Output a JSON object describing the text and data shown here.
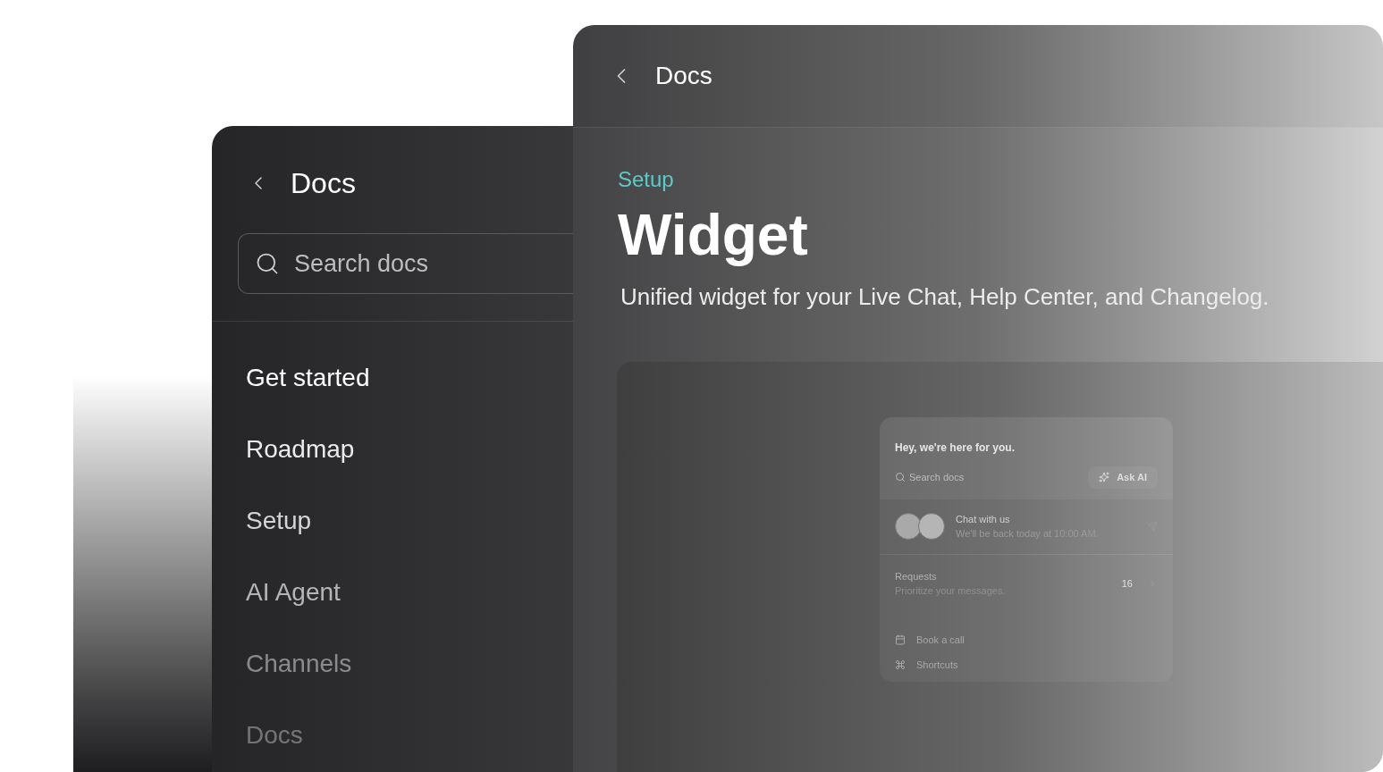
{
  "back_window": {
    "title": "Docs",
    "breadcrumb": "Setup",
    "heading": "Widget",
    "description": "Unified widget for your Live Chat, Help Center, and Changelog.",
    "widget": {
      "greeting": "Hey, we're here for you.",
      "search": {
        "placeholder": "Search docs"
      },
      "ask_button": "Ask AI",
      "chat": {
        "title": "Chat with us",
        "subtitle": "We'll be back today at 10:00 AM."
      },
      "requests": {
        "title": "Requests",
        "subtitle": "Prioritize your messages.",
        "count": "16"
      },
      "links": [
        {
          "kind": "calendar",
          "label": "Book a call"
        },
        {
          "kind": "command",
          "label": "Shortcuts"
        }
      ]
    }
  },
  "front_window": {
    "title": "Docs",
    "search": {
      "placeholder": "Search docs"
    },
    "nav": [
      {
        "label": "Get started"
      },
      {
        "label": "Roadmap"
      },
      {
        "label": "Setup"
      },
      {
        "label": "AI Agent"
      },
      {
        "label": "Channels"
      },
      {
        "label": "Docs"
      }
    ]
  }
}
